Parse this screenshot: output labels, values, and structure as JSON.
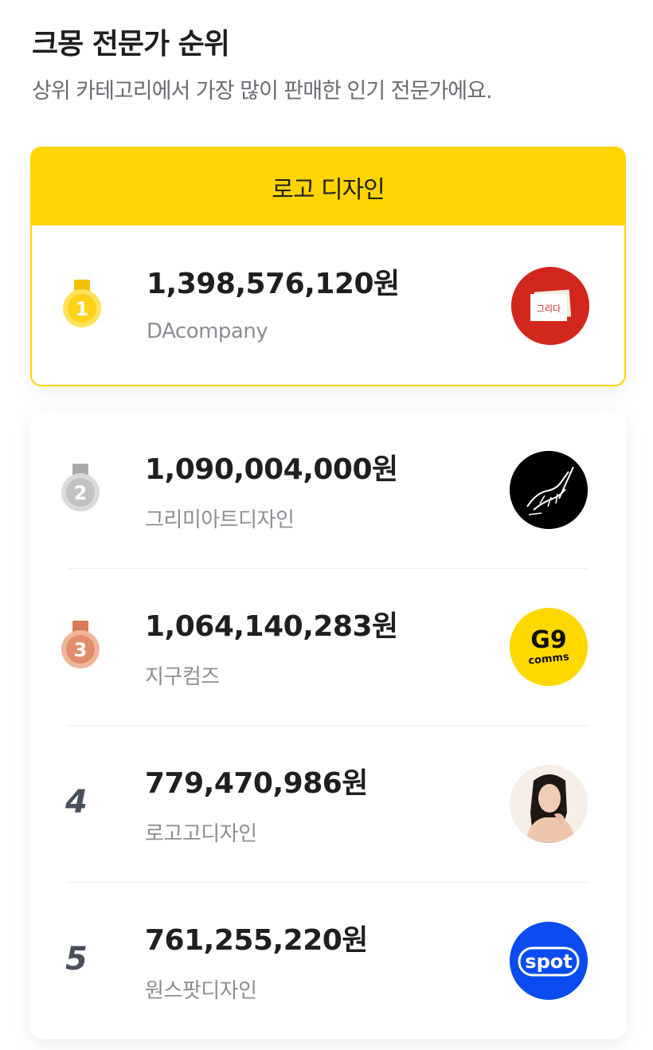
{
  "header": {
    "title": "크몽 전문가 순위",
    "subtitle": "상위 카테고리에서 가장 많이 판매한 인기 전문가에요."
  },
  "category": {
    "label": "로고 디자인",
    "accent": "#FFD400"
  },
  "rankings": [
    {
      "rank": "1",
      "amount": "1,398,576,120원",
      "name": "DAcompany",
      "avatar_icon": "gurida-logo",
      "medal": "gold"
    },
    {
      "rank": "2",
      "amount": "1,090,004,000원",
      "name": "그리미아트디자인",
      "avatar_icon": "hand-drawing-logo",
      "medal": "silver"
    },
    {
      "rank": "3",
      "amount": "1,064,140,283원",
      "name": "지구컴즈",
      "avatar_icon": "g9-comms-logo",
      "medal": "bronze"
    },
    {
      "rank": "4",
      "amount": "779,470,986원",
      "name": "로고고디자인",
      "avatar_icon": "profile-photo",
      "medal": ""
    },
    {
      "rank": "5",
      "amount": "761,255,220원",
      "name": "원스팟디자인",
      "avatar_icon": "spot-logo",
      "medal": ""
    }
  ],
  "logos": {
    "gurida_text": "그리다",
    "g9_main": "G9",
    "g9_sub": "comms",
    "spot_text": "spot"
  }
}
